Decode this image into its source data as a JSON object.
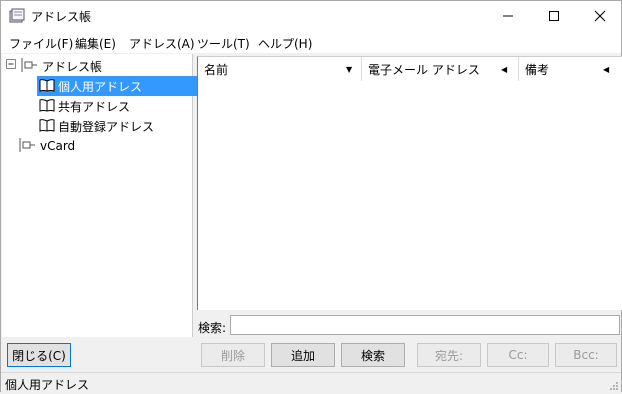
{
  "window": {
    "title": "アドレス帳",
    "minimize_label": "—",
    "maximize_label": "☐",
    "close_label": "✕"
  },
  "menu": [
    {
      "label": "ファイル(F)"
    },
    {
      "label": "編集(E)"
    },
    {
      "label": "アドレス(A)"
    },
    {
      "label": "ツール(T)"
    },
    {
      "label": "ヘルプ(H)"
    }
  ],
  "tree": {
    "root": {
      "label": "アドレス帳",
      "expander": "⊟"
    },
    "children": [
      {
        "label": "個人用アドレス",
        "selected": true
      },
      {
        "label": "共有アドレス"
      },
      {
        "label": "自動登録アドレス"
      }
    ],
    "vcard": {
      "label": "vCard"
    }
  },
  "list": {
    "columns": [
      {
        "label": "名前",
        "arrow": "▼"
      },
      {
        "label": "電子メール アドレス",
        "arrow": "◀"
      },
      {
        "label": "備考",
        "arrow": "◀"
      }
    ]
  },
  "search": {
    "label": "検索:",
    "value": ""
  },
  "buttons": {
    "close": "閉じる(C)",
    "delete": "削除",
    "add": "追加",
    "search": "検索",
    "to": "宛先:",
    "cc": "Cc:",
    "bcc": "Bcc:"
  },
  "status": {
    "text": "個人用アドレス"
  }
}
